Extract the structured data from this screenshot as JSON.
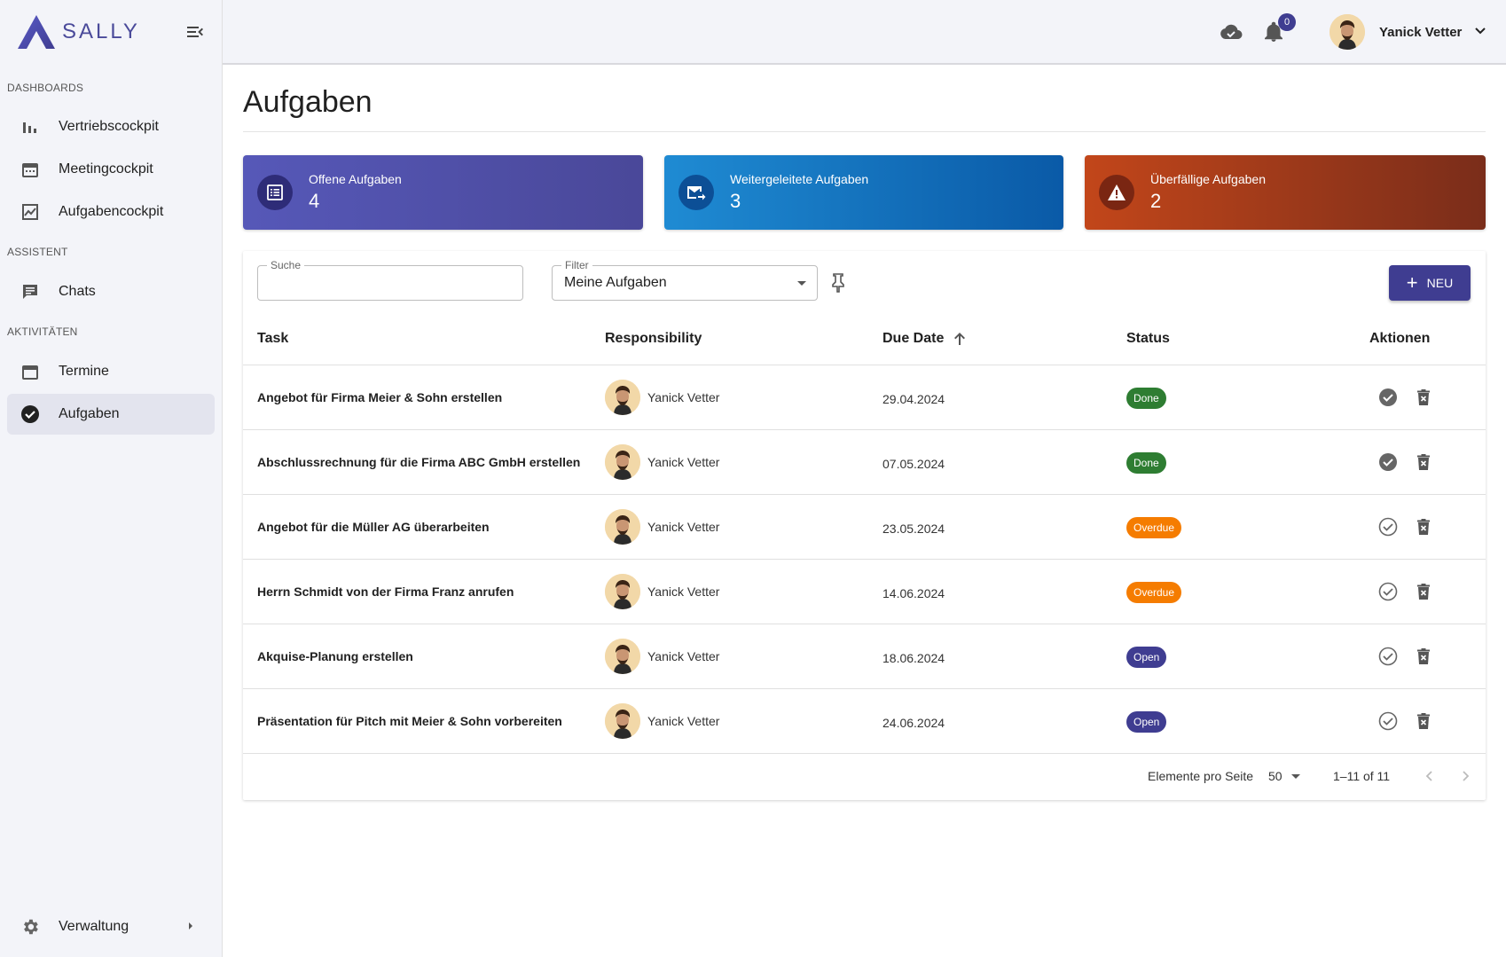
{
  "app": {
    "brand": "SALLY"
  },
  "sidebar": {
    "sections": [
      {
        "label": "DASHBOARDS"
      },
      {
        "label": "ASSISTENT"
      },
      {
        "label": "AKTIVITÄTEN"
      }
    ],
    "items": [
      {
        "label": "Vertriebscockpit",
        "icon": "bar-chart-icon"
      },
      {
        "label": "Meetingcockpit",
        "icon": "calendar-icon"
      },
      {
        "label": "Aufgabencockpit",
        "icon": "trend-chart-icon"
      },
      {
        "label": "Chats",
        "icon": "chat-icon"
      },
      {
        "label": "Termine",
        "icon": "calendar-icon"
      },
      {
        "label": "Aufgaben",
        "icon": "check-circle-icon",
        "active": true
      }
    ],
    "footer": {
      "label": "Verwaltung",
      "icon": "gear-icon"
    }
  },
  "topbar": {
    "notifications_count": "0",
    "user_name": "Yanick Vetter"
  },
  "page": {
    "title": "Aufgaben"
  },
  "stats": [
    {
      "label": "Offene Aufgaben",
      "value": "4",
      "icon": "list-icon",
      "color": "#5658b8"
    },
    {
      "label": "Weitergeleitete Aufgaben",
      "value": "3",
      "icon": "mail-forward-icon",
      "color": "#1f8bd3"
    },
    {
      "label": "Überfällige Aufgaben",
      "value": "2",
      "icon": "warning-icon",
      "color": "#c2461a"
    }
  ],
  "filters": {
    "search_label": "Suche",
    "search_value": "",
    "filter_label": "Filter",
    "filter_value": "Meine Aufgaben",
    "new_button": "NEU"
  },
  "table": {
    "columns": [
      "Task",
      "Responsibility",
      "Due Date",
      "Status",
      "Aktionen"
    ],
    "sort": {
      "column": "Due Date",
      "direction": "ascending"
    },
    "rows": [
      {
        "task": "Angebot für Firma Meier & Sohn erstellen",
        "responsible": "Yanick Vetter",
        "due": "29.04.2024",
        "status": "Done"
      },
      {
        "task": "Abschlussrechnung für die Firma ABC GmbH erstellen",
        "responsible": "Yanick Vetter",
        "due": "07.05.2024",
        "status": "Done"
      },
      {
        "task": "Angebot für die Müller AG überarbeiten",
        "responsible": "Yanick Vetter",
        "due": "23.05.2024",
        "status": "Overdue"
      },
      {
        "task": "Herrn Schmidt von der Firma Franz anrufen",
        "responsible": "Yanick Vetter",
        "due": "14.06.2024",
        "status": "Overdue"
      },
      {
        "task": "Akquise-Planung erstellen",
        "responsible": "Yanick Vetter",
        "due": "18.06.2024",
        "status": "Open"
      },
      {
        "task": "Präsentation für Pitch mit Meier & Sohn vorbereiten",
        "responsible": "Yanick Vetter",
        "due": "24.06.2024",
        "status": "Open"
      }
    ]
  },
  "pagination": {
    "per_page_label": "Elemente pro Seite",
    "per_page_value": "50",
    "range": "1–11 of 11"
  },
  "colors": {
    "primary": "#3f3d91",
    "done": "#2e7d32",
    "overdue": "#f57c00",
    "open": "#3f3d91"
  }
}
